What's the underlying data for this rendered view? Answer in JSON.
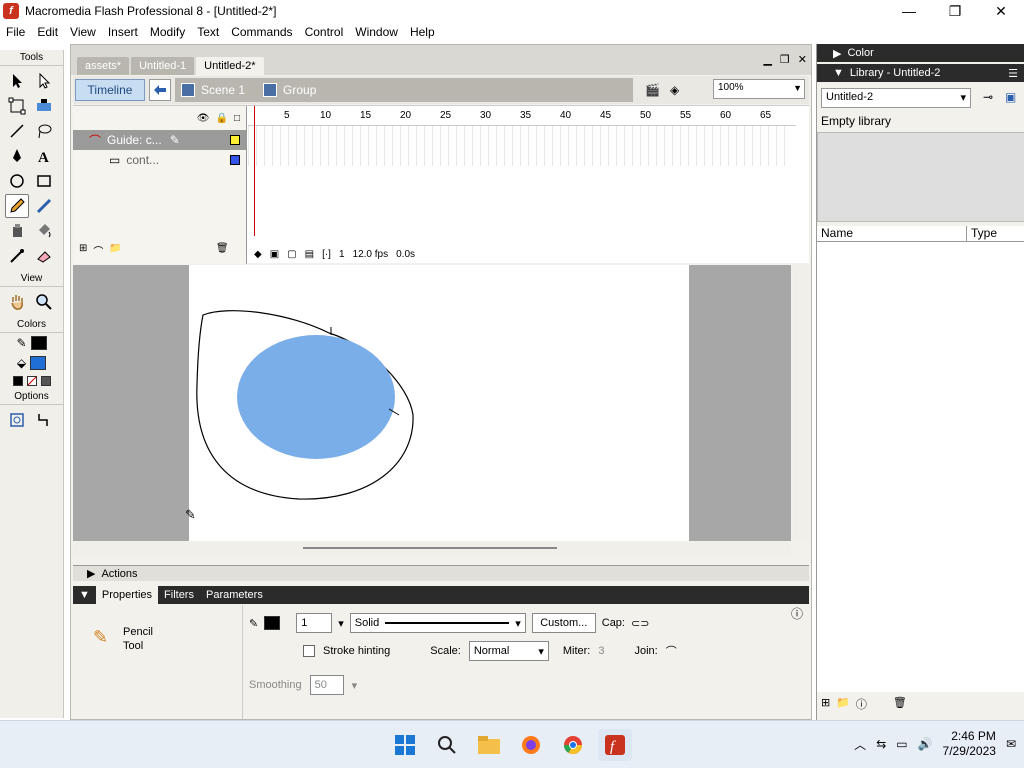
{
  "window": {
    "title": "Macromedia Flash Professional 8 - [Untitled-2*]"
  },
  "menu": {
    "items": [
      "File",
      "Edit",
      "View",
      "Insert",
      "Modify",
      "Text",
      "Commands",
      "Control",
      "Window",
      "Help"
    ]
  },
  "tools": {
    "title": "Tools",
    "view_title": "View",
    "colors_title": "Colors",
    "options_title": "Options",
    "stroke_color": "#000000",
    "fill_color": "#1f6fd6"
  },
  "doc_tabs": [
    "assets*",
    "Untitled-1",
    "Untitled-2*"
  ],
  "edit_bar": {
    "timeline_label": "Timeline",
    "scene_label": "Scene 1",
    "group_label": "Group",
    "zoom": "100%"
  },
  "timeline": {
    "layers": [
      {
        "name": "Guide: c...",
        "selected": true
      },
      {
        "name": "cont...",
        "selected": false
      }
    ],
    "ruler": [
      "5",
      "10",
      "15",
      "20",
      "25",
      "30",
      "35",
      "40",
      "45",
      "50",
      "55",
      "60",
      "65"
    ],
    "frame": "1",
    "fps": "12.0 fps",
    "time": "0.0s"
  },
  "stage": {
    "fill_color": "#7aaee8"
  },
  "panels": {
    "actions": "Actions",
    "tabs": [
      "Properties",
      "Filters",
      "Parameters"
    ],
    "tool_name_1": "Pencil",
    "tool_name_2": "Tool",
    "stroke_width": "1",
    "stroke_style": "Solid",
    "custom_label": "Custom...",
    "cap_label": "Cap:",
    "stroke_hinting": "Stroke hinting",
    "scale_label": "Scale:",
    "scale_value": "Normal",
    "miter_label": "Miter:",
    "miter_value": "3",
    "join_label": "Join:",
    "smoothing_label": "Smoothing",
    "smoothing_value": "50"
  },
  "right": {
    "color_title": "Color",
    "library_title": "Library - Untitled-2",
    "library_select": "Untitled-2",
    "empty_text": "Empty library",
    "col_name": "Name",
    "col_type": "Type"
  },
  "taskbar": {
    "time": "2:46 PM",
    "date": "7/29/2023"
  }
}
